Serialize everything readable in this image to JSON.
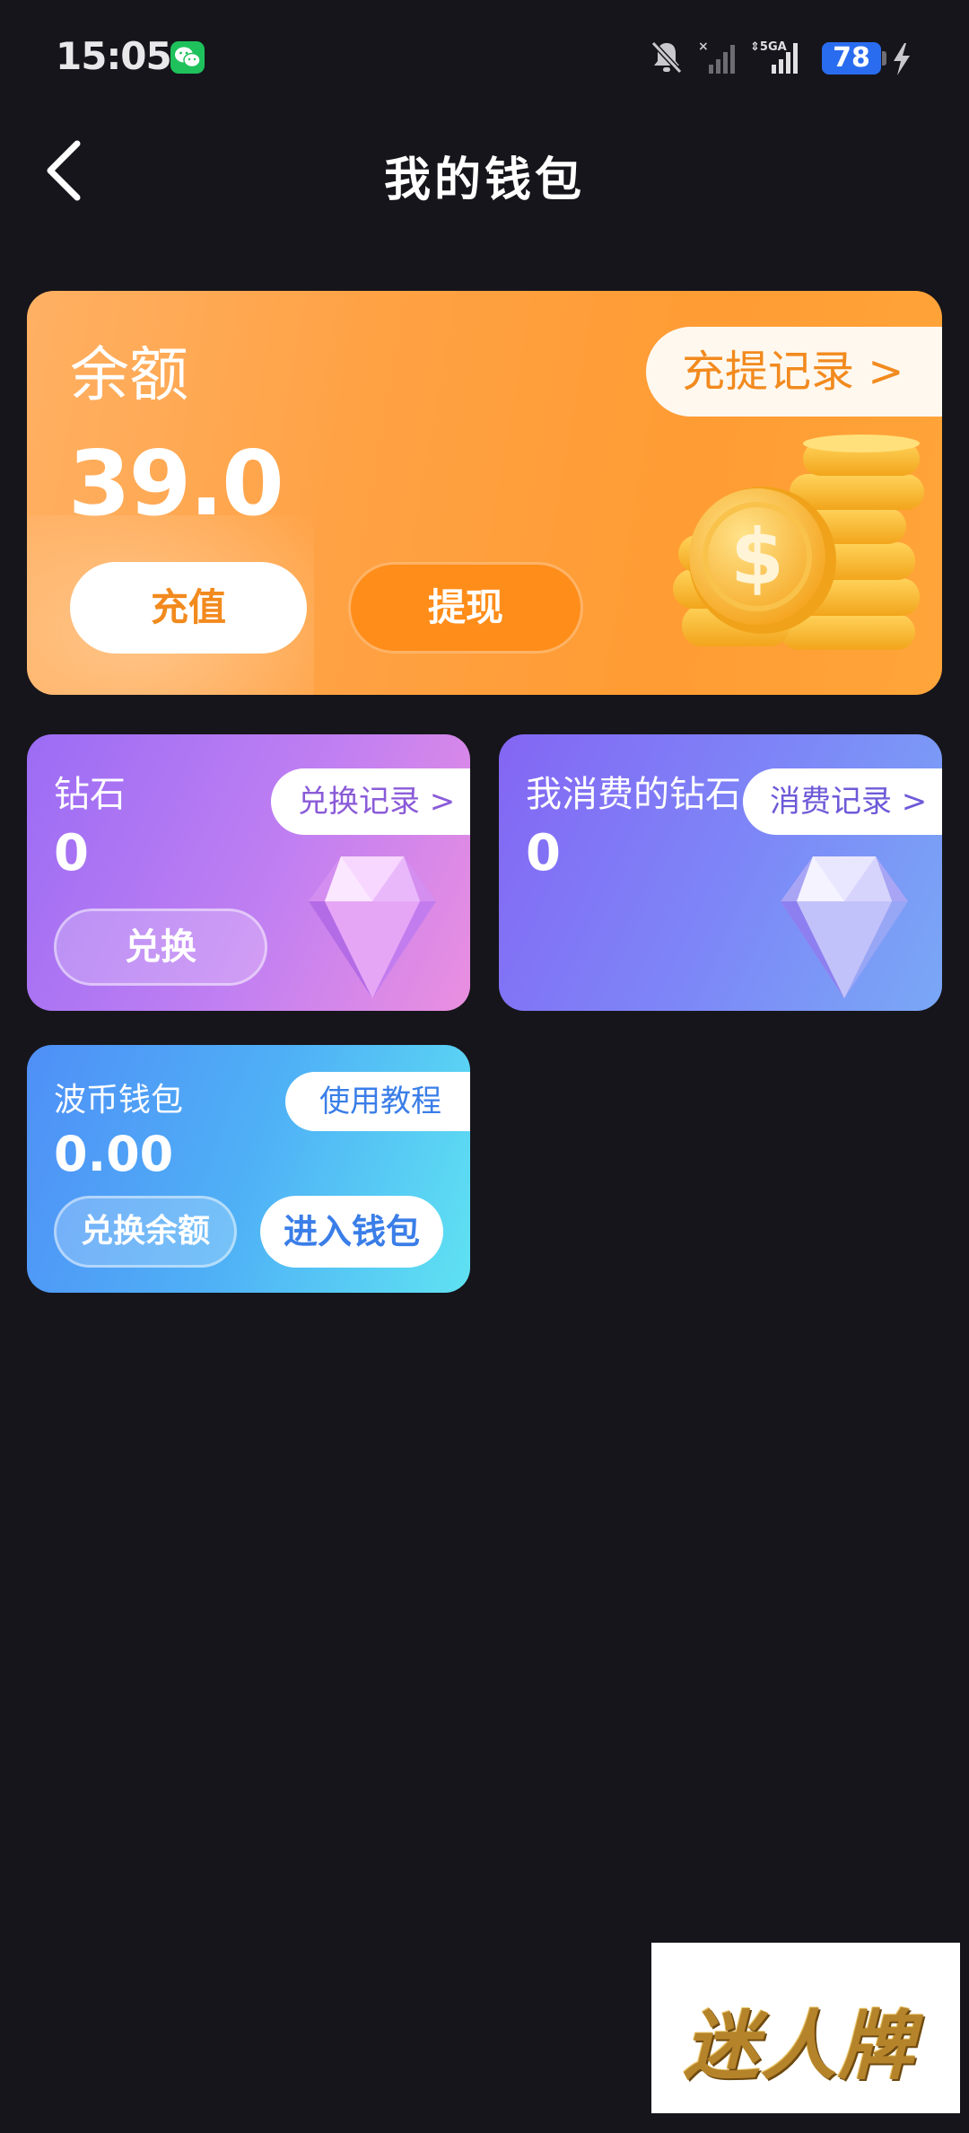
{
  "status_bar": {
    "time": "15:05",
    "battery": "78",
    "icons": [
      "wechat-icon",
      "mute-icon",
      "signal-icon",
      "signal-5g-icon",
      "battery-icon",
      "charging-icon"
    ]
  },
  "header": {
    "title": "我的钱包",
    "back_icon": "chevron-left-icon"
  },
  "balance_card": {
    "label": "余额",
    "value": "39.0",
    "records_link": "充提记录 >",
    "recharge_label": "充值",
    "withdraw_label": "提现",
    "accent_color": "#ff9c33"
  },
  "diamond_card": {
    "title": "钻石",
    "value": "0",
    "records_link": "兑换记录 >",
    "exchange_label": "兑换"
  },
  "spent_card": {
    "title": "我消费的钻石",
    "value": "0",
    "records_link": "消费记录 >"
  },
  "bocoin_card": {
    "title": "波币钱包",
    "value": "0.00",
    "tutorial_link": "使用教程",
    "exchange_balance_label": "兑换余额",
    "enter_wallet_label": "进入钱包"
  },
  "watermark": {
    "text": "迷人牌"
  }
}
